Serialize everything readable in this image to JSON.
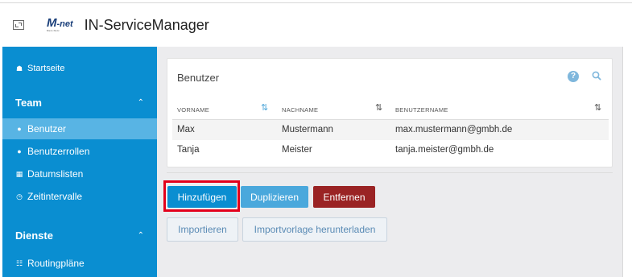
{
  "header": {
    "window_icon": "window-resize-icon",
    "logo_text": "M-net",
    "logo_m": "M",
    "logo_rest": "-net",
    "logo_sub": "Mein Netz",
    "title": "IN-ServiceManager"
  },
  "sidebar": {
    "home": {
      "icon": "home-icon",
      "label": "Startseite"
    },
    "sections": [
      {
        "label": "Team",
        "chevron": "chevron-up-icon",
        "items": [
          {
            "icon": "user-icon",
            "label": "Benutzer",
            "active": true
          },
          {
            "icon": "users-roles-icon",
            "label": "Benutzerrollen"
          },
          {
            "icon": "calendar-icon",
            "label": "Datumslisten"
          },
          {
            "icon": "clock-icon",
            "label": "Zeitintervalle"
          }
        ]
      },
      {
        "label": "Dienste",
        "chevron": "chevron-up-icon",
        "items": [
          {
            "icon": "sitemap-icon",
            "label": "Routingpläne"
          }
        ]
      }
    ]
  },
  "panel": {
    "title": "Benutzer",
    "help_icon": "question-circle-icon",
    "search_icon": "search-icon",
    "columns": [
      "VORNAME",
      "NACHNAME",
      "BENUTZERNAME"
    ],
    "rows": [
      [
        "Max",
        "Mustermann",
        "max.mustermann@gmbh.de"
      ],
      [
        "Tanja",
        "Meister",
        "tanja.meister@gmbh.de"
      ]
    ]
  },
  "actions": {
    "add": "Hinzufügen",
    "duplicate": "Duplizieren",
    "remove": "Entfernen",
    "import": "Importieren",
    "download_template": "Importvorlage herunterladen"
  },
  "colors": {
    "sidebar": "#0a8ed1",
    "sidebar_active": "#58b4e4",
    "primary": "#0a8ed1",
    "danger": "#9a2324",
    "highlight": "#e3001b"
  }
}
